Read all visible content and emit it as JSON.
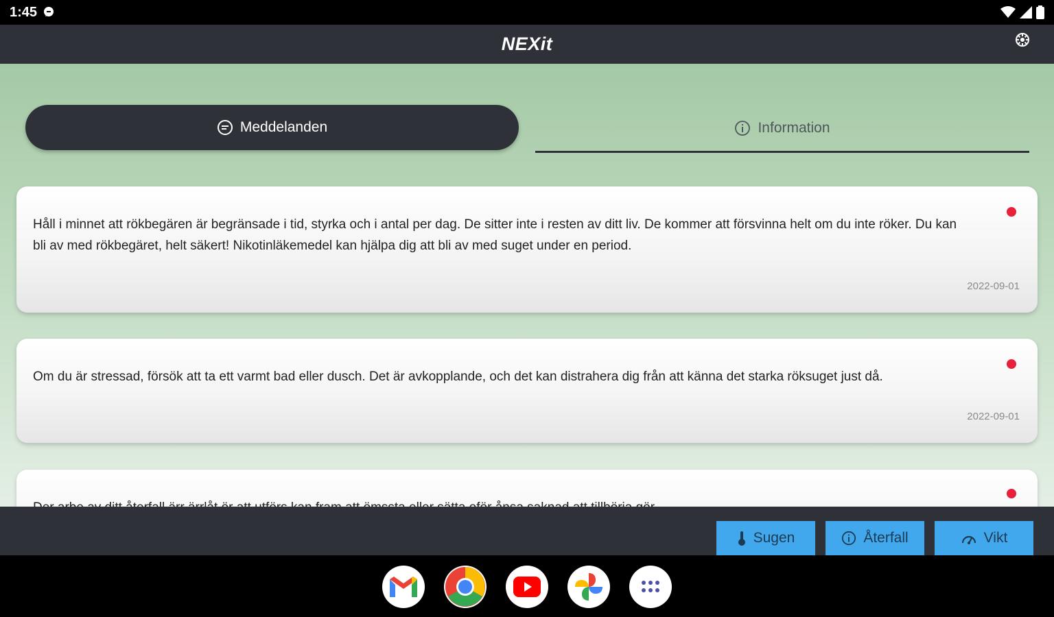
{
  "status": {
    "time": "1:45"
  },
  "app": {
    "title": "NEXit"
  },
  "tabs": [
    {
      "label": "Meddelanden",
      "active": true
    },
    {
      "label": "Information",
      "active": false
    }
  ],
  "messages": [
    {
      "text": "Håll i minnet att rökbegären är begränsade i tid, styrka och i antal per dag. De sitter inte i resten av ditt liv. De kommer att försvinna helt om du inte röker. Du kan bli av med rökbegäret, helt säkert! Nikotinläkemedel kan hjälpa dig att bli av med suget under en period.",
      "date": "2022-09-01",
      "unread": true
    },
    {
      "text": "Om du är stressad, försök att ta ett varmt bad eller dusch. Det är avkopplande, och det kan distrahera dig från att känna det starka röksuget just då.",
      "date": "2022-09-01",
      "unread": true
    },
    {
      "text": "Der arbe av ditt återfall ärr ärrlåt ör att utförs kan fram att ömssta eller sätta oför ånsa saknad att tillbörja gör.",
      "date": "",
      "unread": true
    }
  ],
  "nav": {
    "sugen": "Sugen",
    "aterfall": "Återfall",
    "vikt": "Vikt"
  },
  "colors": {
    "primary_dark": "#2e3238",
    "accent_blue": "#42a8ee",
    "unread_dot": "#e8203a",
    "bg_green": "#a4c9a5"
  }
}
